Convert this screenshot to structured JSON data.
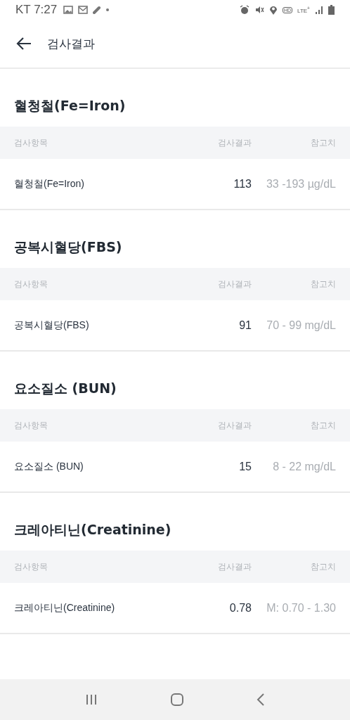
{
  "status_bar": {
    "carrier": "KT",
    "time": "7:27",
    "hd": "HD",
    "network": "LTE$^{+}$"
  },
  "header": {
    "title": "검사결과"
  },
  "sections": [
    {
      "title": "혈청철(Fe=Iron)",
      "columns": [
        "검사항목",
        "검사결과",
        "참고치"
      ],
      "rows": [
        {
          "item": "혈청철(Fe=Iron)",
          "result": "113",
          "reference": "33 -193 µg/dL"
        }
      ]
    },
    {
      "title": "공복시혈당(FBS)",
      "columns": [
        "검사항목",
        "검사결과",
        "참고치"
      ],
      "rows": [
        {
          "item": "공복시혈당(FBS)",
          "result": "91",
          "reference": "70 - 99 mg/dL"
        }
      ]
    },
    {
      "title": "요소질소 (BUN)",
      "columns": [
        "검사항목",
        "검사결과",
        "참고치"
      ],
      "rows": [
        {
          "item": "요소질소 (BUN)",
          "result": "15",
          "reference": "8 - 22 mg/dL"
        }
      ]
    },
    {
      "title": "크레아티닌(Creatinine)",
      "columns": [
        "검사항목",
        "검사결과",
        "참고치"
      ],
      "rows": [
        {
          "item": "크레아티닌(Creatinine)",
          "result": "0.78",
          "reference": "M: 0.70 - 1.30"
        }
      ]
    }
  ]
}
